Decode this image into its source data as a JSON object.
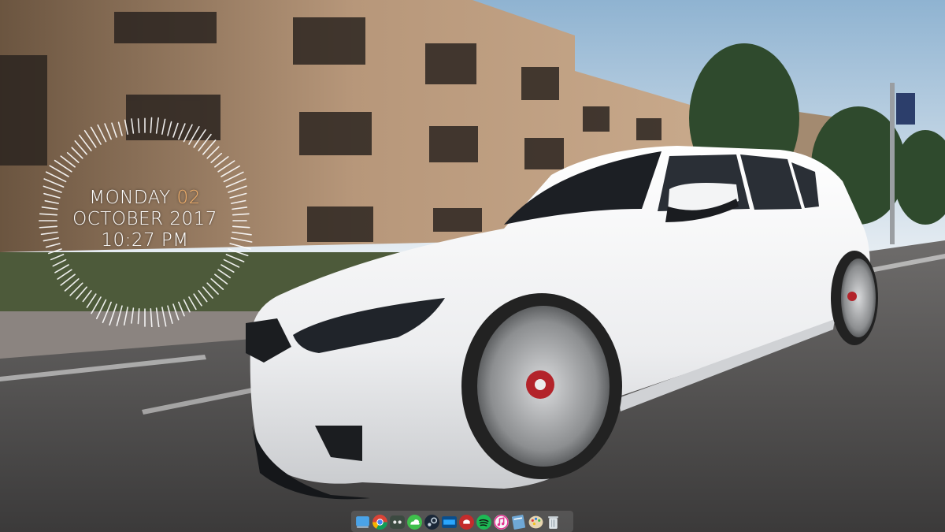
{
  "clock": {
    "day_name": "MONDAY",
    "day_number": "02",
    "month_year": "OCTOBER 2017",
    "time": "10:27 PM",
    "accent_color": "#f2b06b",
    "text_color": "#ffffff"
  },
  "dock": {
    "apps": [
      {
        "name": "finder-icon"
      },
      {
        "name": "chrome-icon"
      },
      {
        "name": "discord-icon"
      },
      {
        "name": "cloud-sync-icon"
      },
      {
        "name": "steam-icon"
      },
      {
        "name": "battle-net-icon"
      },
      {
        "name": "vpn-shield-icon"
      },
      {
        "name": "spotify-icon"
      },
      {
        "name": "itunes-icon"
      },
      {
        "name": "notes-icon"
      },
      {
        "name": "paint-icon"
      },
      {
        "name": "trash-icon"
      }
    ]
  }
}
